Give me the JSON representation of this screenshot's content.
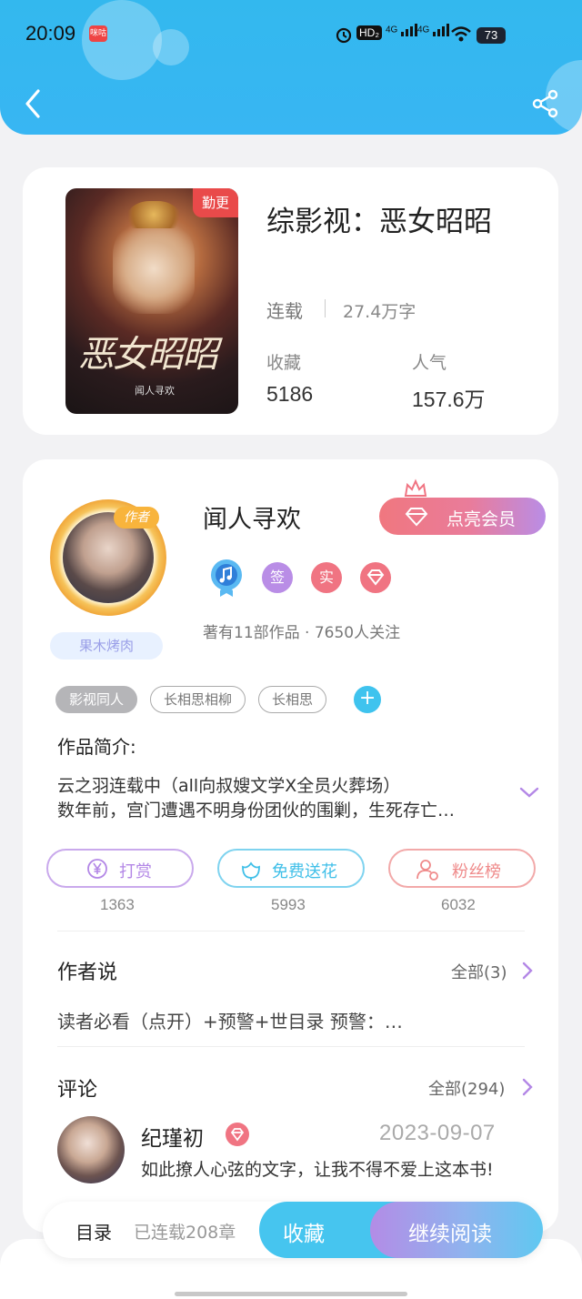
{
  "status_bar": {
    "time": "20:09",
    "app_chip": "咪咕",
    "battery": "73",
    "hd": "HD₂",
    "net1": "4G",
    "net2": "4G"
  },
  "book": {
    "title": "综影视：恶女昭昭",
    "cover_tag": "勤更",
    "cover_title": "恶女昭昭",
    "cover_author": "闻人寻欢",
    "status": "连载",
    "words": "27.4万字",
    "collect_label": "收藏",
    "collect_value": "5186",
    "popularity_label": "人气",
    "popularity_value": "157.6万"
  },
  "author": {
    "name": "闻人寻欢",
    "badge": "作者",
    "fan_tag": "果木烤肉",
    "member_button": "点亮会员",
    "badges": [
      "签",
      "实"
    ],
    "works_text": "著有11部作品 · 7650人关注"
  },
  "tags": [
    "影视同人",
    "长相思相柳",
    "长相思"
  ],
  "tag_add": "+",
  "intro": {
    "label": "作品简介:",
    "line1": "云之羽连载中（all向叔嫂文学X全员火葬场）",
    "line2": "数年前，宫门遭遇不明身份团伙的围剿，生死存亡…"
  },
  "actions": [
    {
      "label": "打赏",
      "count": "1363",
      "color": "#b387e6"
    },
    {
      "label": "免费送花",
      "count": "5993",
      "color": "#3fbfe8"
    },
    {
      "label": "粉丝榜",
      "count": "6032",
      "color": "#ef8a8a"
    }
  ],
  "author_says": {
    "title": "作者说",
    "more": "全部(3)",
    "text": "读者必看（点开）+预警+世目录  预警：…"
  },
  "comments": {
    "title": "评论",
    "more": "全部(294)",
    "item": {
      "name": "纪瑾初",
      "date": "2023-09-07",
      "text": "如此撩人心弦的文字，让我不得不爱上这本书!"
    }
  },
  "bottom": {
    "toc": "目录",
    "toc_sub": "已连载208章",
    "collect": "收藏",
    "read": "继续阅读"
  },
  "colors": {
    "header": "#38b6f3",
    "accent": "#46c5ef",
    "vip": "#f07482"
  }
}
